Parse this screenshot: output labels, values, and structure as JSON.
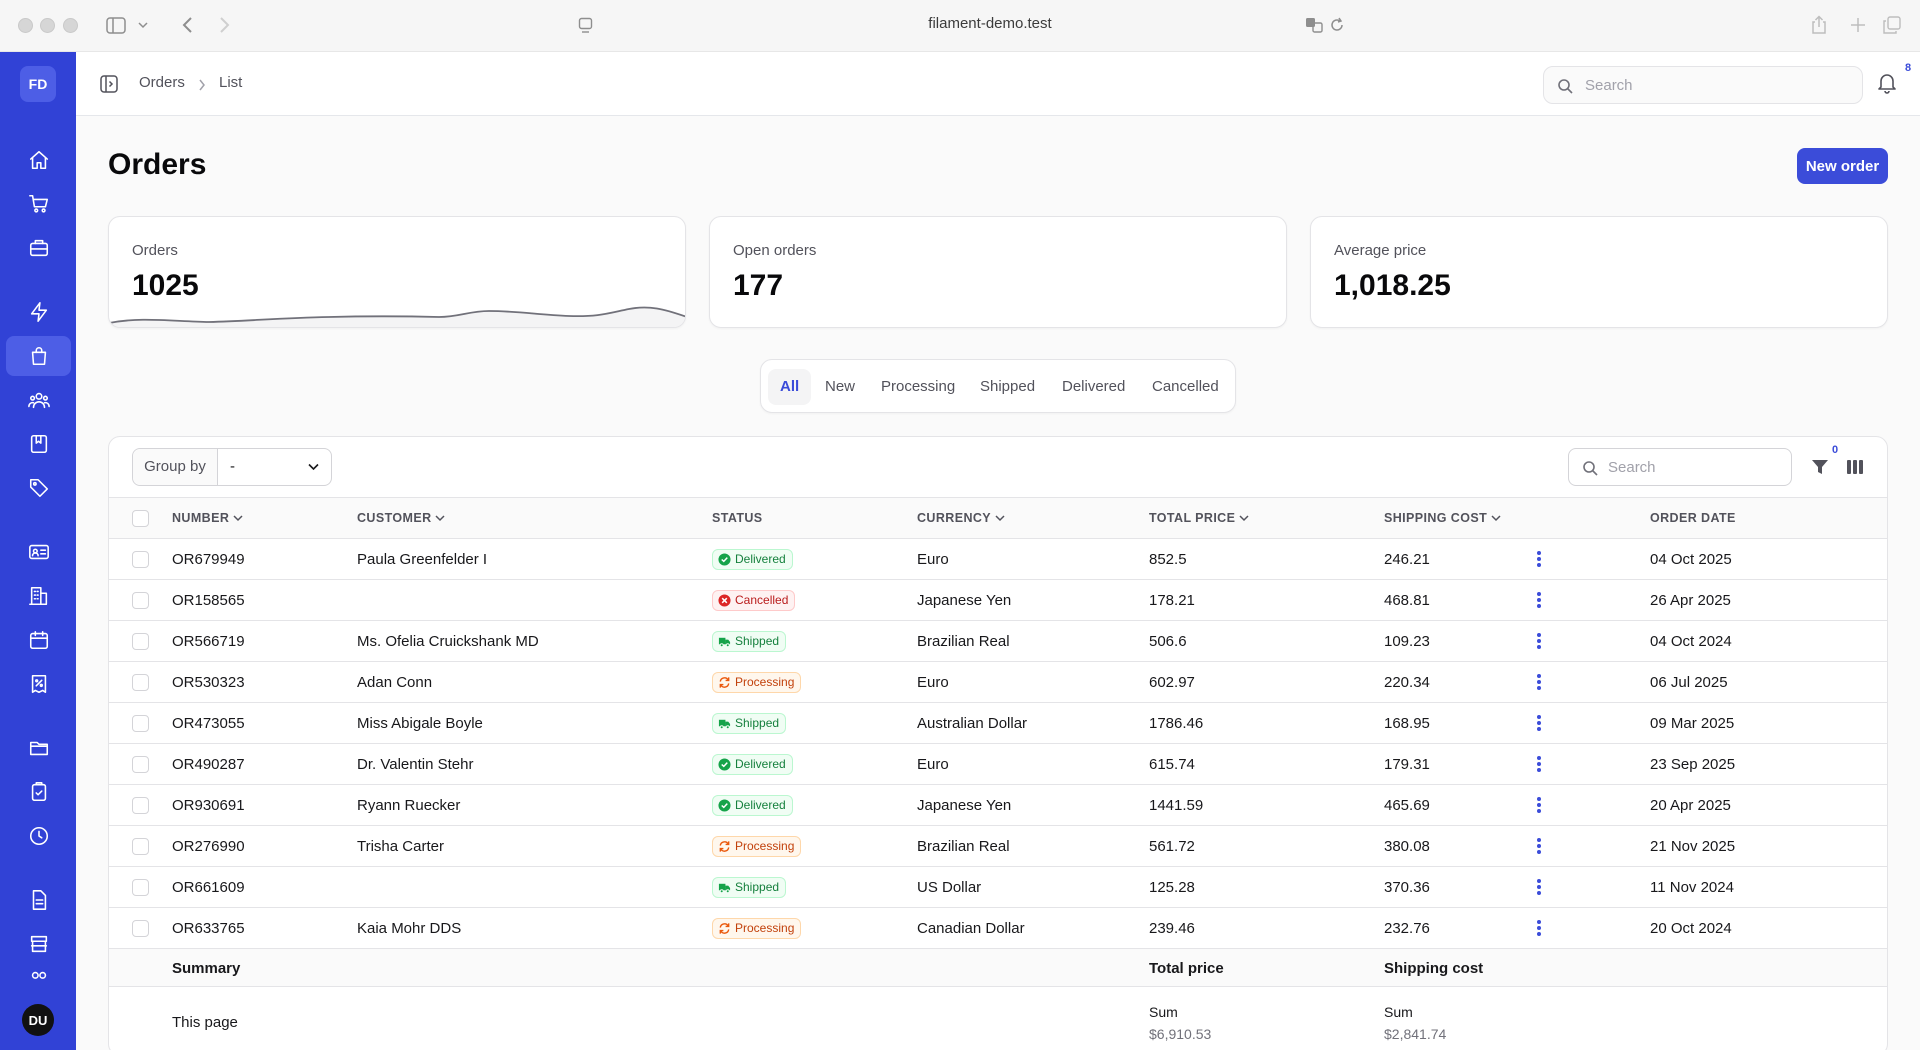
{
  "browser": {
    "url": "filament-demo.test"
  },
  "sidebar": {
    "avatar": "FD",
    "user": "DU",
    "items": [
      {
        "icon": "home-icon"
      },
      {
        "icon": "cart-icon"
      },
      {
        "icon": "briefcase-icon"
      },
      {
        "icon": "bolt-icon"
      },
      {
        "icon": "shopping-bag-icon",
        "active": true
      },
      {
        "icon": "users-icon"
      },
      {
        "icon": "book-icon"
      },
      {
        "icon": "tag-icon"
      },
      {
        "icon": "id-card-icon"
      },
      {
        "icon": "building-icon"
      },
      {
        "icon": "calendar-icon"
      },
      {
        "icon": "receipt-percent-icon"
      },
      {
        "icon": "folder-icon"
      },
      {
        "icon": "clipboard-check-icon"
      },
      {
        "icon": "clock-icon"
      },
      {
        "icon": "document-icon"
      },
      {
        "icon": "archive-icon"
      }
    ]
  },
  "topbar": {
    "breadcrumb": [
      "Orders",
      "List"
    ],
    "search_placeholder": "Search",
    "notification_count": "8"
  },
  "page": {
    "title": "Orders",
    "new_button": "New order"
  },
  "stats": [
    {
      "label": "Orders",
      "value": "1025",
      "has_chart": true
    },
    {
      "label": "Open orders",
      "value": "177"
    },
    {
      "label": "Average price",
      "value": "1,018.25"
    }
  ],
  "tabs": [
    "All",
    "New",
    "Processing",
    "Shipped",
    "Delivered",
    "Cancelled"
  ],
  "active_tab": "All",
  "table": {
    "group_by_label": "Group by",
    "group_by_value": "-",
    "search_placeholder": "Search",
    "filter_count": "0",
    "columns": {
      "number": "NUMBER",
      "customer": "CUSTOMER",
      "status": "STATUS",
      "currency": "CURRENCY",
      "total": "TOTAL PRICE",
      "shipping": "SHIPPING COST",
      "date": "ORDER DATE"
    },
    "rows": [
      {
        "number": "OR679949",
        "customer": "Paula Greenfelder I",
        "status": "Delivered",
        "currency": "Euro",
        "total": "852.5",
        "shipping": "246.21",
        "date": "04 Oct 2025"
      },
      {
        "number": "OR158565",
        "customer": "",
        "status": "Cancelled",
        "currency": "Japanese Yen",
        "total": "178.21",
        "shipping": "468.81",
        "date": "26 Apr 2025"
      },
      {
        "number": "OR566719",
        "customer": "Ms. Ofelia Cruickshank MD",
        "status": "Shipped",
        "currency": "Brazilian Real",
        "total": "506.6",
        "shipping": "109.23",
        "date": "04 Oct 2024"
      },
      {
        "number": "OR530323",
        "customer": "Adan Conn",
        "status": "Processing",
        "currency": "Euro",
        "total": "602.97",
        "shipping": "220.34",
        "date": "06 Jul 2025"
      },
      {
        "number": "OR473055",
        "customer": "Miss Abigale Boyle",
        "status": "Shipped",
        "currency": "Australian Dollar",
        "total": "1786.46",
        "shipping": "168.95",
        "date": "09 Mar 2025"
      },
      {
        "number": "OR490287",
        "customer": "Dr. Valentin Stehr",
        "status": "Delivered",
        "currency": "Euro",
        "total": "615.74",
        "shipping": "179.31",
        "date": "23 Sep 2025"
      },
      {
        "number": "OR930691",
        "customer": "Ryann Ruecker",
        "status": "Delivered",
        "currency": "Japanese Yen",
        "total": "1441.59",
        "shipping": "465.69",
        "date": "20 Apr 2025"
      },
      {
        "number": "OR276990",
        "customer": "Trisha Carter",
        "status": "Processing",
        "currency": "Brazilian Real",
        "total": "561.72",
        "shipping": "380.08",
        "date": "21 Nov 2025"
      },
      {
        "number": "OR661609",
        "customer": "",
        "status": "Shipped",
        "currency": "US Dollar",
        "total": "125.28",
        "shipping": "370.36",
        "date": "11 Nov 2024"
      },
      {
        "number": "OR633765",
        "customer": "Kaia Mohr DDS",
        "status": "Processing",
        "currency": "Canadian Dollar",
        "total": "239.46",
        "shipping": "232.76",
        "date": "20 Oct 2024"
      }
    ],
    "summary": {
      "label": "Summary",
      "total_label": "Total price",
      "shipping_label": "Shipping cost",
      "this_page": "This page",
      "sum_label": "Sum",
      "total_sum": "$6,910.53",
      "shipping_sum": "$2,841.74"
    }
  },
  "colors": {
    "primary": "#3b4cd9",
    "sidebar": "#3142d6"
  }
}
